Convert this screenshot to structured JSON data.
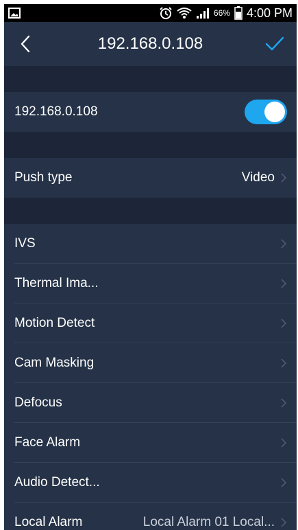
{
  "status_bar": {
    "battery_percent": "66%",
    "time": "4:00 PM",
    "icons": [
      "gallery-icon",
      "alarm-clock-icon",
      "wifi-icon",
      "signal-icon",
      "battery-icon"
    ]
  },
  "header": {
    "title": "192.168.0.108",
    "back_icon": "chevron-left-icon",
    "confirm_icon": "checkmark-icon"
  },
  "device": {
    "label": "192.168.0.108",
    "enabled": true
  },
  "push": {
    "label": "Push type",
    "value": "Video"
  },
  "events": [
    {
      "label": "IVS",
      "value": ""
    },
    {
      "label": "Thermal Ima...",
      "value": ""
    },
    {
      "label": "Motion Detect",
      "value": ""
    },
    {
      "label": "Cam Masking",
      "value": ""
    },
    {
      "label": "Defocus",
      "value": ""
    },
    {
      "label": "Face Alarm",
      "value": ""
    },
    {
      "label": "Audio Detect...",
      "value": ""
    },
    {
      "label": "Local Alarm",
      "value": "Local Alarm 01  Local..."
    }
  ],
  "colors": {
    "background": "#1c2638",
    "row": "#253247",
    "accent": "#1ea6ef",
    "divider": "#34425a"
  }
}
